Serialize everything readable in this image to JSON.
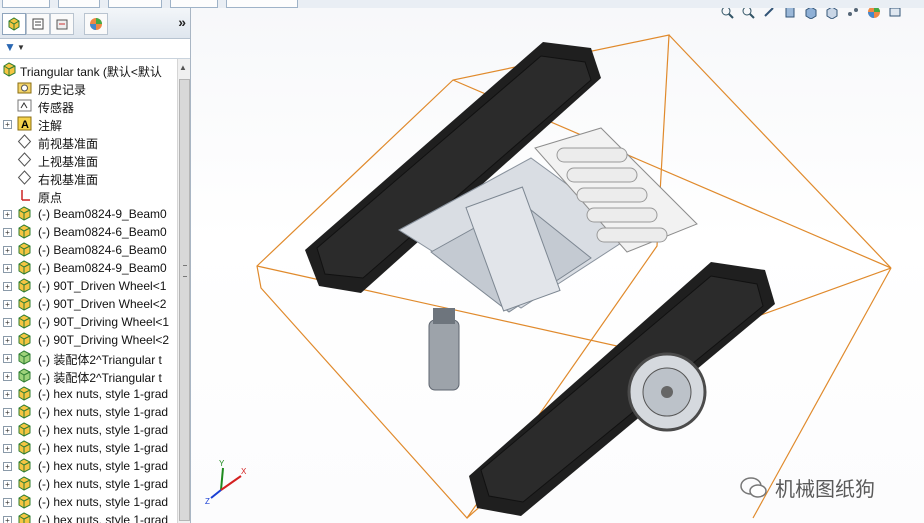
{
  "left_panel": {
    "collapse_glyph": "»",
    "tree": {
      "root": "Triangular tank  (默认<默认",
      "items": [
        {
          "label": "历史记录",
          "icon": "history-folder-icon",
          "expand": false
        },
        {
          "label": "传感器",
          "icon": "sensor-icon",
          "expand": false
        },
        {
          "label": "注解",
          "icon": "annotation-icon",
          "expand": true
        },
        {
          "label": "前视基准面",
          "icon": "plane-icon",
          "expand": false
        },
        {
          "label": "上视基准面",
          "icon": "plane-icon",
          "expand": false
        },
        {
          "label": "右视基准面",
          "icon": "plane-icon",
          "expand": false
        },
        {
          "label": "原点",
          "icon": "origin-icon",
          "expand": false
        },
        {
          "label": "(-) Beam0824-9_Beam0",
          "icon": "part-icon",
          "expand": true
        },
        {
          "label": "(-) Beam0824-6_Beam0",
          "icon": "part-icon",
          "expand": true
        },
        {
          "label": "(-) Beam0824-6_Beam0",
          "icon": "part-icon",
          "expand": true
        },
        {
          "label": "(-) Beam0824-9_Beam0",
          "icon": "part-icon",
          "expand": true
        },
        {
          "label": "(-) 90T_Driven Wheel<1",
          "icon": "part-icon",
          "expand": true
        },
        {
          "label": "(-) 90T_Driven Wheel<2",
          "icon": "part-icon",
          "expand": true
        },
        {
          "label": "(-) 90T_Driving Wheel<1",
          "icon": "part-icon",
          "expand": true
        },
        {
          "label": "(-) 90T_Driving Wheel<2",
          "icon": "part-icon",
          "expand": true
        },
        {
          "label": "(-) 装配体2^Triangular t",
          "icon": "assembly-icon",
          "expand": true
        },
        {
          "label": "(-) 装配体2^Triangular t",
          "icon": "assembly-icon",
          "expand": true
        },
        {
          "label": "(-) hex nuts, style 1-grad",
          "icon": "part-icon",
          "expand": true
        },
        {
          "label": "(-) hex nuts, style 1-grad",
          "icon": "part-icon",
          "expand": true
        },
        {
          "label": "(-) hex nuts, style 1-grad",
          "icon": "part-icon",
          "expand": true
        },
        {
          "label": "(-) hex nuts, style 1-grad",
          "icon": "part-icon",
          "expand": true
        },
        {
          "label": "(-) hex nuts, style 1-grad",
          "icon": "part-icon",
          "expand": true
        },
        {
          "label": "(-) hex nuts, style 1-grad",
          "icon": "part-icon",
          "expand": true
        },
        {
          "label": "(-) hex nuts, style 1-grad",
          "icon": "part-icon",
          "expand": true
        },
        {
          "label": "(-) hex nuts, style 1-grad",
          "icon": "part-icon",
          "expand": true
        }
      ]
    }
  },
  "viewport": {
    "watermark": "机械图纸狗",
    "triad": {
      "x": "X",
      "y": "Y",
      "z": "Z"
    },
    "colors": {
      "bounding_box": "#e08a2c",
      "track": "#1f1f1f",
      "plate": "#d9dde3",
      "battery": "#ececec"
    }
  }
}
